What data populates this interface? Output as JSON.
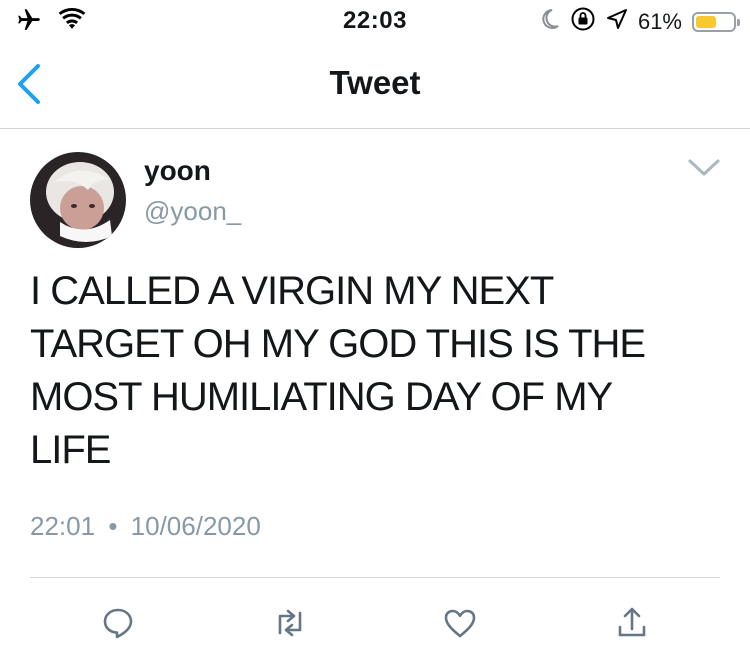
{
  "status_bar": {
    "time": "22:03",
    "battery_percent": "61%",
    "battery_level": 0.61,
    "left_icons": [
      "airplane-icon",
      "wifi-icon"
    ],
    "right_icons": [
      "moon-icon",
      "orientation-lock-icon",
      "location-arrow-icon",
      "battery-icon"
    ]
  },
  "nav": {
    "title": "Tweet",
    "back_icon": "chevron-left-icon",
    "accent_color": "#1da1f2"
  },
  "tweet": {
    "display_name": "yoon",
    "handle": "@yoon_",
    "text_lines": [
      "I CALLED A VIRGIN MY NEXT",
      "TARGET OH MY GOD THIS IS THE",
      "MOST HUMILIATING DAY OF MY",
      "LIFE"
    ],
    "time": "22:01",
    "separator": "•",
    "date": "10/06/2020",
    "more_icon": "chevron-down-icon"
  },
  "actions": [
    "reply-icon",
    "retweet-icon",
    "like-icon",
    "share-icon"
  ],
  "colors": {
    "text": "#14171a",
    "secondary": "#8899a6",
    "accent": "#1da1f2",
    "divider": "#d4d7da",
    "battery": "#f7c82f"
  }
}
